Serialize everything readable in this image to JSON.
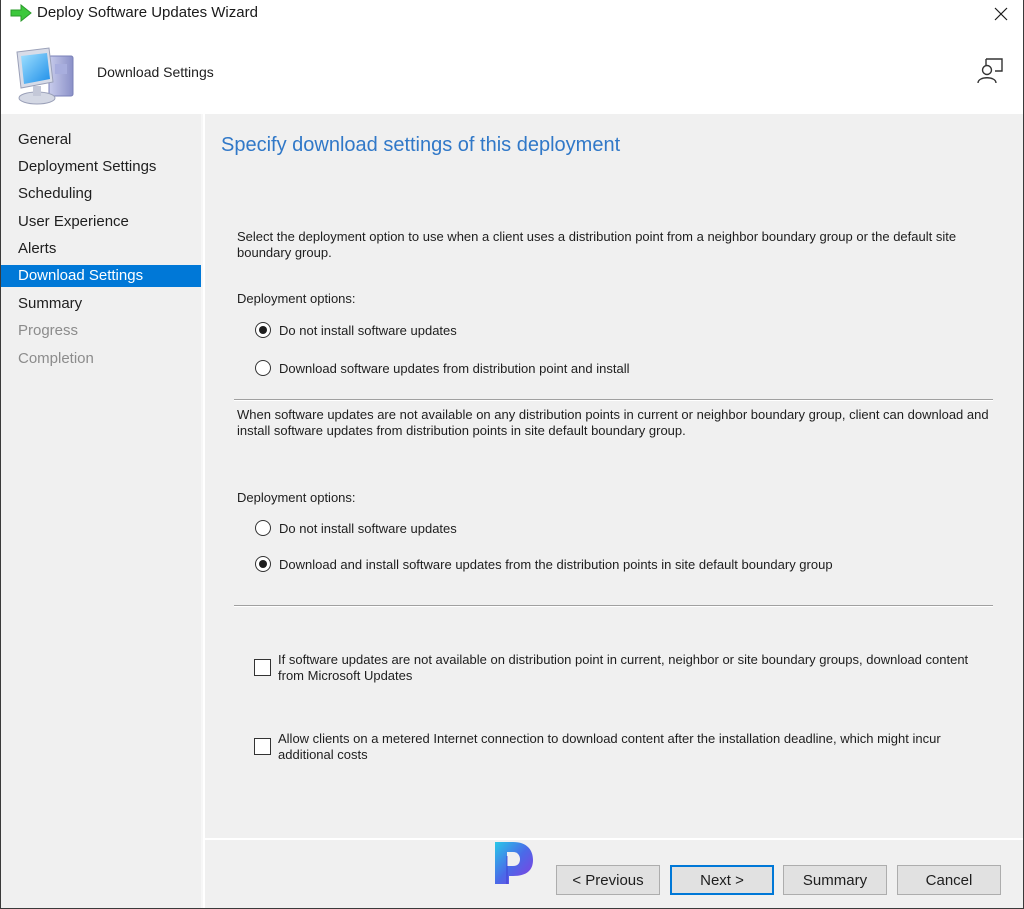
{
  "window": {
    "title": "Deploy Software Updates Wizard",
    "icons": {
      "title": "green-arrow-icon",
      "close": "close-icon"
    }
  },
  "header": {
    "title": "Download Settings",
    "icons": {
      "page": "computer-icon",
      "feedback": "feedback-icon"
    }
  },
  "sidebar": {
    "items": [
      {
        "label": "General",
        "state": "normal"
      },
      {
        "label": "Deployment Settings",
        "state": "normal"
      },
      {
        "label": "Scheduling",
        "state": "normal"
      },
      {
        "label": "User Experience",
        "state": "normal"
      },
      {
        "label": "Alerts",
        "state": "normal"
      },
      {
        "label": "Download Settings",
        "state": "active"
      },
      {
        "label": "Summary",
        "state": "normal"
      },
      {
        "label": "Progress",
        "state": "disabled"
      },
      {
        "label": "Completion",
        "state": "disabled"
      }
    ],
    "active_color": "#0078d7"
  },
  "content": {
    "heading": "Specify download settings of this deployment",
    "heading_color": "#3078c8",
    "section1": {
      "description": "Select the deployment option to use when a client uses a distribution point from a neighbor boundary group or the default site boundary group.",
      "options_label": "Deployment options:",
      "options": [
        {
          "label": "Do not install software updates",
          "selected": true
        },
        {
          "label": "Download software updates from distribution point and install",
          "selected": false
        }
      ]
    },
    "section2": {
      "description": "When software updates are not available on any distribution points in current or neighbor boundary group, client can download and install software updates from distribution points in site default boundary group.",
      "options_label": "Deployment options:",
      "options": [
        {
          "label": "Do not install software updates",
          "selected": false
        },
        {
          "label": "Download and install software updates from the distribution points in site default boundary group",
          "selected": true
        }
      ]
    },
    "checkboxes": [
      {
        "label": "If software updates are not available on distribution point in current, neighbor or site boundary groups, download content from Microsoft Updates",
        "checked": false
      },
      {
        "label": "Allow clients on a metered Internet connection to download content after the installation deadline, which might incur additional costs",
        "checked": false
      }
    ]
  },
  "footer": {
    "logo": "p-logo-icon",
    "buttons": {
      "previous": "< Previous",
      "next": "Next >",
      "summary": "Summary",
      "cancel": "Cancel"
    },
    "default_button_color": "#0078d7"
  }
}
